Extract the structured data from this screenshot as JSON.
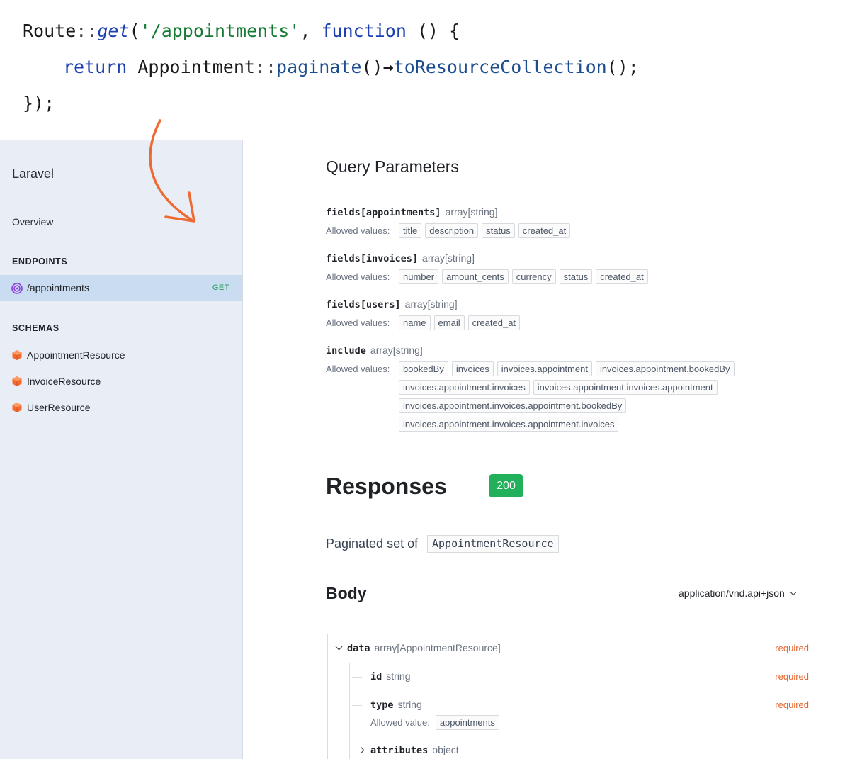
{
  "code": {
    "line1": {
      "route": "Route",
      "sep1": "::",
      "get": "get",
      "open": "(",
      "path": "'/appointments'",
      "comma": ", ",
      "function": "function",
      "rest": " () {"
    },
    "line2": {
      "ret": "return",
      "model": " Appointment",
      "sep": "::",
      "paginate": "paginate",
      "parens1": "()",
      "arrow": "→",
      "to": "toResourceCollection",
      "parens2": "();"
    },
    "line3": "});"
  },
  "sidebar": {
    "title": "Laravel",
    "overview": "Overview",
    "endpoints_heading": "ENDPOINTS",
    "endpoint": {
      "label": "/appointments",
      "method": "GET"
    },
    "schemas_heading": "SCHEMAS",
    "schemas": [
      "AppointmentResource",
      "InvoiceResource",
      "UserResource"
    ]
  },
  "query": {
    "heading": "Query Parameters",
    "allowed_label": "Allowed values:",
    "params": [
      {
        "name": "fields[appointments]",
        "type": "array[string]",
        "values": [
          "title",
          "description",
          "status",
          "created_at"
        ]
      },
      {
        "name": "fields[invoices]",
        "type": "array[string]",
        "values": [
          "number",
          "amount_cents",
          "currency",
          "status",
          "created_at"
        ]
      },
      {
        "name": "fields[users]",
        "type": "array[string]",
        "values": [
          "name",
          "email",
          "created_at"
        ]
      },
      {
        "name": "include",
        "type": "array[string]",
        "values": [
          "bookedBy",
          "invoices",
          "invoices.appointment",
          "invoices.appointment.bookedBy",
          "invoices.appointment.invoices",
          "invoices.appointment.invoices.appointment",
          "invoices.appointment.invoices.appointment.bookedBy",
          "invoices.appointment.invoices.appointment.invoices"
        ]
      }
    ]
  },
  "responses": {
    "heading": "Responses",
    "status": "200",
    "paginated_text": "Paginated set of",
    "resource": "AppointmentResource",
    "body_heading": "Body",
    "content_type": "application/vnd.api+json",
    "fields": {
      "data": {
        "name": "data",
        "type": "array[AppointmentResource]",
        "required": "required"
      },
      "id": {
        "name": "id",
        "type": "string",
        "required": "required"
      },
      "type": {
        "name": "type",
        "type": "string",
        "required": "required",
        "allowed_label": "Allowed value:",
        "allowed_value": "appointments"
      },
      "attributes": {
        "name": "attributes",
        "type": "object"
      }
    }
  },
  "colors": {
    "accent_orange": "#e8622a",
    "status_green": "#22b05a",
    "sidebar_bg": "#e9eef6",
    "active_bg": "#c9dcf2"
  },
  "icons": {
    "endpoint": "target-icon",
    "schema": "cube-icon",
    "arrow": "curved-arrow-icon"
  }
}
